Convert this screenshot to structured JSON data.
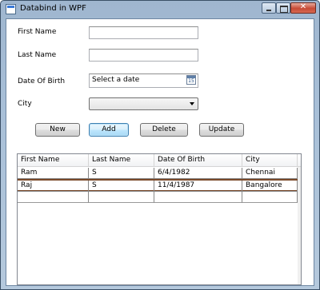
{
  "window": {
    "title": "Databind in WPF"
  },
  "form": {
    "first_name_label": "First Name",
    "last_name_label": "Last Name",
    "dob_label": "Date Of Birth",
    "dob_placeholder": "Select a date",
    "calendar_day": "15",
    "city_label": "City",
    "city_value": ""
  },
  "buttons": {
    "new": "New",
    "add": "Add",
    "delete": "Delete",
    "update": "Update"
  },
  "grid": {
    "columns": [
      "First Name",
      "Last Name",
      "Date Of Birth",
      "City"
    ],
    "rows": [
      [
        "Ram",
        "S",
        "6/4/1982",
        "Chennai"
      ],
      [
        "Raj",
        "S",
        "11/4/1987",
        "Bangalore"
      ]
    ]
  }
}
